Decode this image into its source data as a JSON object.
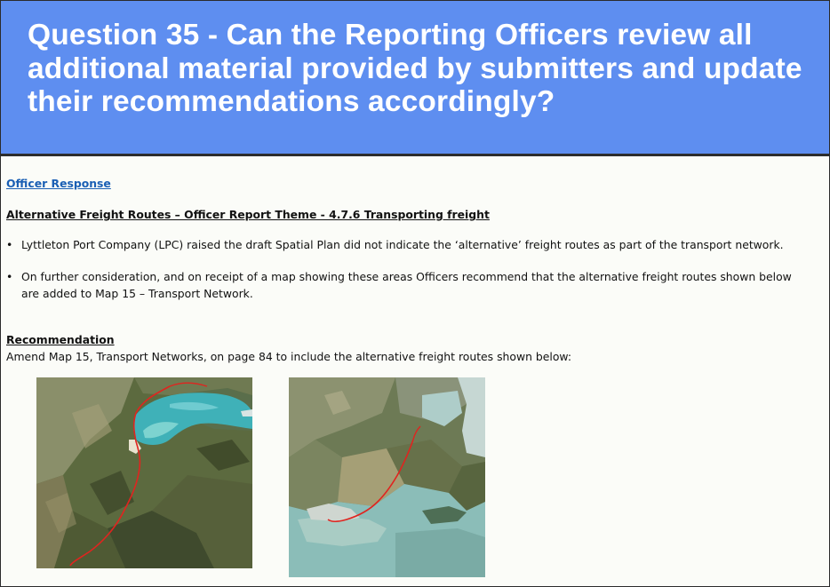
{
  "header": {
    "title": "Question 35 - Can the Reporting Officers review all additional material provided by submitters and update their recommendations accordingly?"
  },
  "content": {
    "officer_response_link": "Officer Response",
    "theme_heading": "Alternative Freight Routes – Officer Report Theme - 4.7.6 Transporting freight",
    "bullets": [
      "Lyttleton Port Company  (LPC) raised the draft Spatial Plan did not indicate the ‘alternative’ freight routes as part of the transport network.",
      "On further consideration, and on receipt of a map showing these areas Officers recommend that the alternative freight routes shown below are added to Map 15 – Transport Network."
    ],
    "bullet_glyph": "•",
    "recommendation_heading": "Recommendation",
    "recommendation_text": "Amend Map 15, Transport Networks, on page 84 to include the alternative freight routes shown below:"
  },
  "colors": {
    "header_bg": "#5e8ef0",
    "link": "#1a5fb4",
    "route": "#e0241f"
  }
}
